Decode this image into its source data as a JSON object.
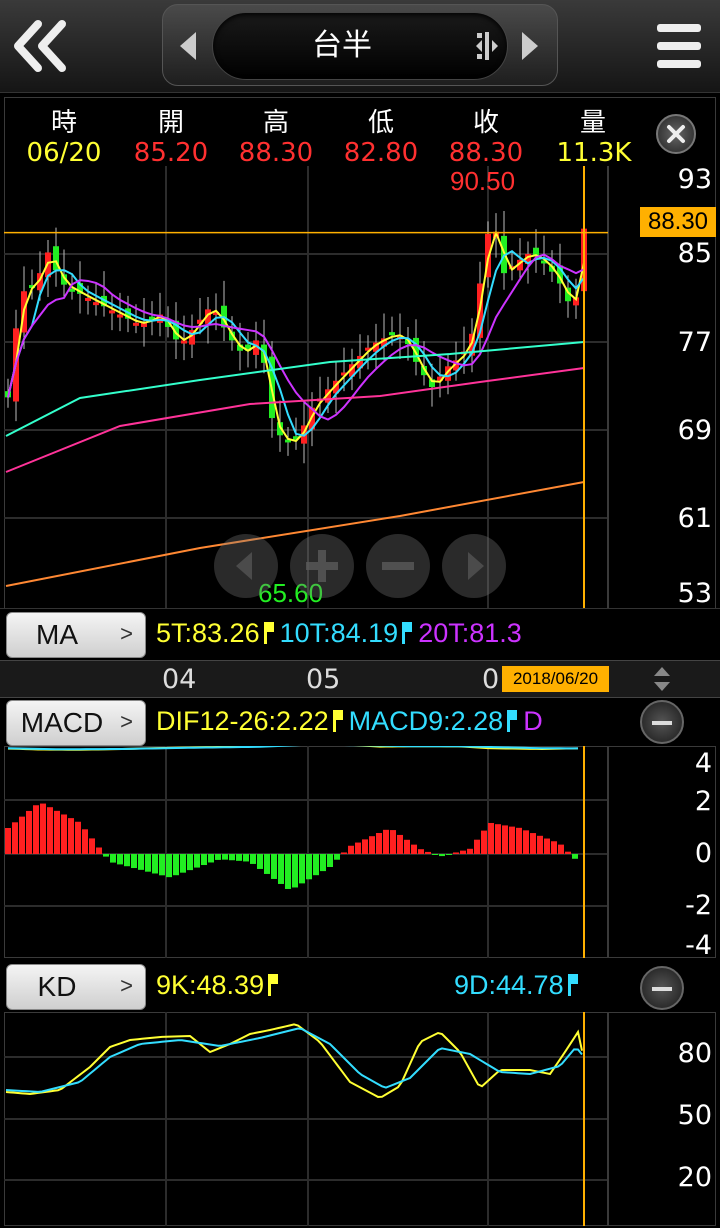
{
  "app": {
    "title": "台半"
  },
  "header": {
    "labels": [
      "時",
      "開",
      "高",
      "低",
      "收",
      "量"
    ],
    "values": [
      "06/20",
      "85.20",
      "88.30",
      "82.80",
      "88.30",
      "11.3K"
    ],
    "value_colors": [
      "#ffff33",
      "#ff3030",
      "#ff3030",
      "#ff3030",
      "#ff3030",
      "#ffff33"
    ]
  },
  "price_panel": {
    "y_ticks": [
      "93",
      "85",
      "77",
      "69",
      "61",
      "53"
    ],
    "current_price": "88.30",
    "high_label": "90.50",
    "low_label": "65.60"
  },
  "ma": {
    "button_label": "MA",
    "legend": [
      {
        "text": "5T:83.26",
        "color": "#ffff33"
      },
      {
        "text": "10T:84.19",
        "color": "#33ddff"
      },
      {
        "text": "20T:81.3",
        "color": "#cc33ff"
      }
    ]
  },
  "time_axis": {
    "labels": [
      "04",
      "05",
      "0"
    ],
    "cursor_date": "2018/06/20"
  },
  "macd": {
    "button_label": "MACD",
    "legend": [
      {
        "text": "DIF12-26:2.22",
        "color": "#ffff33"
      },
      {
        "text": "MACD9:2.28",
        "color": "#33ddff"
      },
      {
        "text": "D",
        "color": "#cc33ff"
      }
    ],
    "y_ticks": [
      "4",
      "2",
      "0",
      "-2",
      "-4"
    ]
  },
  "kd": {
    "button_label": "KD",
    "legend": [
      {
        "text": "9K:48.39",
        "color": "#ffff33"
      },
      {
        "text": "9D:44.78",
        "color": "#33ddff"
      }
    ],
    "y_ticks": [
      "80",
      "50",
      "20"
    ]
  },
  "colors": {
    "up": "#ff2020",
    "down": "#22ee22",
    "cursor": "#ffb000",
    "ma5": "#ffff33",
    "ma10": "#33ddff",
    "ma20": "#cc33ff",
    "ma60": "#33ffcc",
    "ma120": "#ff3399",
    "ma240": "#ff8833"
  },
  "icons": {
    "back": "double-chevron-left-icon",
    "menu": "hamburger-menu-icon",
    "close": "close-icon",
    "zoom_in": "zoom-in-icon",
    "zoom_out": "zoom-out-icon",
    "scroll_left": "scroll-left-icon",
    "scroll_right": "scroll-right-icon"
  }
}
